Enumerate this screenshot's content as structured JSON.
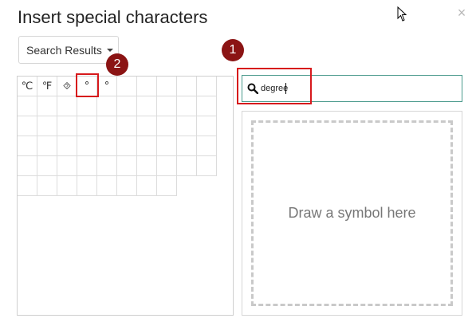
{
  "dialog": {
    "title": "Insert special characters",
    "close": "×"
  },
  "category": {
    "selected": "Search Results"
  },
  "characters": [
    "℃",
    "℉",
    "⯑",
    "°",
    "°",
    "",
    "",
    "",
    "",
    "",
    "",
    "",
    "",
    "",
    "",
    "",
    "",
    "",
    "",
    "",
    "",
    "",
    "",
    "",
    "",
    "",
    "",
    "",
    "",
    "",
    "",
    "",
    "",
    "",
    "",
    "",
    "",
    "",
    "",
    "",
    "",
    "",
    "",
    "",
    "",
    "",
    "",
    "",
    "",
    "",
    "",
    "",
    "",
    "",
    "",
    "",
    "",
    ""
  ],
  "search": {
    "value": "degree",
    "placeholder": ""
  },
  "draw": {
    "label": "Draw a symbol here"
  },
  "annotations": {
    "step1": "1",
    "step2": "2"
  },
  "colors": {
    "badge": "#8b1414",
    "highlight": "#d7191c",
    "focus_border": "#4a9a8c"
  },
  "icons": {
    "search": "search-icon",
    "close": "close-icon",
    "dropdown": "caret-down-icon",
    "cursor": "mouse-pointer-icon"
  }
}
